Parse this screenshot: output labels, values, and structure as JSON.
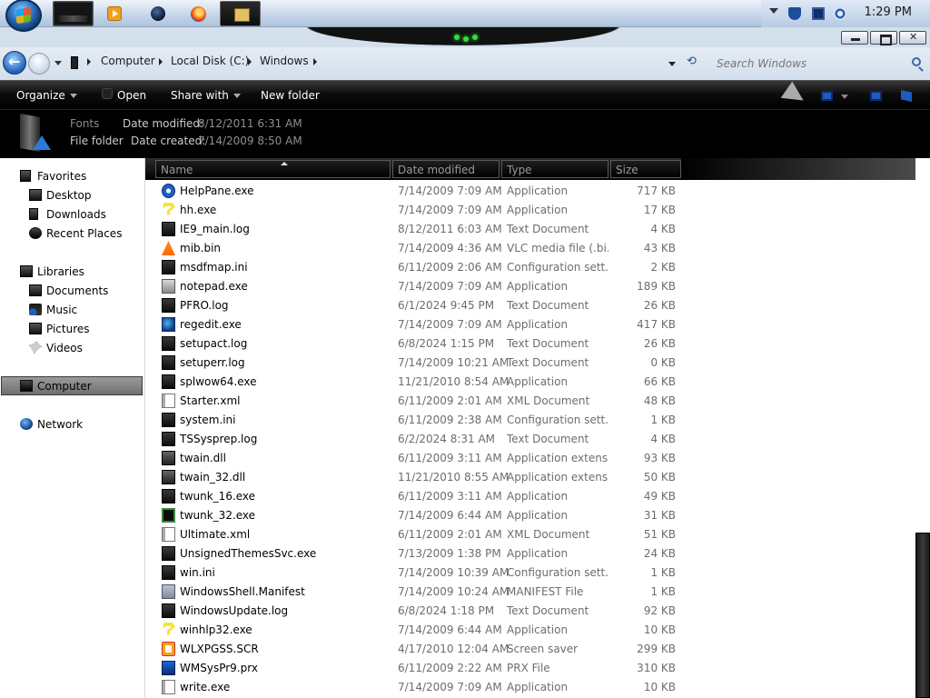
{
  "taskbar": {
    "clock": "1:29 PM"
  },
  "address": {
    "crumbs": [
      "Computer",
      "Local Disk (C:)",
      "Windows"
    ],
    "search_placeholder": "Search Windows"
  },
  "toolbar": {
    "organize_label": "Organize",
    "open_label": "Open",
    "share_label": "Share with",
    "new_folder_label": "New folder"
  },
  "details": {
    "name": "Fonts",
    "kind": "File folder",
    "modified_label": "Date modified:",
    "modified_value": "8/12/2011 6:31 AM",
    "created_label": "Date created:",
    "created_value": "7/14/2009 8:50 AM"
  },
  "nav": {
    "favorites": "Favorites",
    "desktop": "Desktop",
    "downloads": "Downloads",
    "recent_places": "Recent Places",
    "libraries": "Libraries",
    "documents": "Documents",
    "music": "Music",
    "pictures": "Pictures",
    "videos": "Videos",
    "computer": "Computer",
    "network": "Network"
  },
  "columns": {
    "name": "Name",
    "date_modified": "Date modified",
    "type": "Type",
    "size": "Size"
  },
  "files": [
    {
      "name": "HelpPane.exe",
      "date": "7/14/2009 7:09 AM",
      "type": "Application",
      "size": "717 KB",
      "icon": "help-icon"
    },
    {
      "name": "hh.exe",
      "date": "7/14/2009 7:09 AM",
      "type": "Application",
      "size": "17 KB",
      "icon": "question-icon"
    },
    {
      "name": "IE9_main.log",
      "date": "8/12/2011 6:03 AM",
      "type": "Text Document",
      "size": "4 KB",
      "icon": "text-doc-icon"
    },
    {
      "name": "mib.bin",
      "date": "7/14/2009 4:36 AM",
      "type": "VLC media file (.bi...",
      "size": "43 KB",
      "icon": "vlc-cone-icon"
    },
    {
      "name": "msdfmap.ini",
      "date": "6/11/2009 2:06 AM",
      "type": "Configuration sett...",
      "size": "2 KB",
      "icon": "config-icon"
    },
    {
      "name": "notepad.exe",
      "date": "7/14/2009 7:09 AM",
      "type": "Application",
      "size": "189 KB",
      "icon": "notepad-icon"
    },
    {
      "name": "PFRO.log",
      "date": "6/1/2024 9:45 PM",
      "type": "Text Document",
      "size": "26 KB",
      "icon": "text-doc-icon"
    },
    {
      "name": "regedit.exe",
      "date": "7/14/2009 7:09 AM",
      "type": "Application",
      "size": "417 KB",
      "icon": "regedit-icon"
    },
    {
      "name": "setupact.log",
      "date": "6/8/2024 1:15 PM",
      "type": "Text Document",
      "size": "26 KB",
      "icon": "text-doc-icon"
    },
    {
      "name": "setuperr.log",
      "date": "7/14/2009 10:21 AM",
      "type": "Text Document",
      "size": "0 KB",
      "icon": "text-doc-icon"
    },
    {
      "name": "splwow64.exe",
      "date": "11/21/2010 8:54 AM",
      "type": "Application",
      "size": "66 KB",
      "icon": "app-window-icon"
    },
    {
      "name": "Starter.xml",
      "date": "6/11/2009 2:01 AM",
      "type": "XML Document",
      "size": "48 KB",
      "icon": "xml-icon"
    },
    {
      "name": "system.ini",
      "date": "6/11/2009 2:38 AM",
      "type": "Configuration sett...",
      "size": "1 KB",
      "icon": "config-icon"
    },
    {
      "name": "TSSysprep.log",
      "date": "6/2/2024 8:31 AM",
      "type": "Text Document",
      "size": "4 KB",
      "icon": "text-doc-icon"
    },
    {
      "name": "twain.dll",
      "date": "6/11/2009 3:11 AM",
      "type": "Application extens...",
      "size": "93 KB",
      "icon": "dll-icon"
    },
    {
      "name": "twain_32.dll",
      "date": "11/21/2010 8:55 AM",
      "type": "Application extens...",
      "size": "50 KB",
      "icon": "dll-icon"
    },
    {
      "name": "twunk_16.exe",
      "date": "6/11/2009 3:11 AM",
      "type": "Application",
      "size": "49 KB",
      "icon": "app-window-icon"
    },
    {
      "name": "twunk_32.exe",
      "date": "7/14/2009 6:44 AM",
      "type": "Application",
      "size": "31 KB",
      "icon": "twunk-icon"
    },
    {
      "name": "Ultimate.xml",
      "date": "6/11/2009 2:01 AM",
      "type": "XML Document",
      "size": "51 KB",
      "icon": "xml-icon"
    },
    {
      "name": "UnsignedThemesSvc.exe",
      "date": "7/13/2009 1:38 PM",
      "type": "Application",
      "size": "24 KB",
      "icon": "app-window-icon"
    },
    {
      "name": "win.ini",
      "date": "7/14/2009 10:39 AM",
      "type": "Configuration sett...",
      "size": "1 KB",
      "icon": "config-icon"
    },
    {
      "name": "WindowsShell.Manifest",
      "date": "7/14/2009 10:24 AM",
      "type": "MANIFEST File",
      "size": "1 KB",
      "icon": "manifest-icon"
    },
    {
      "name": "WindowsUpdate.log",
      "date": "6/8/2024 1:18 PM",
      "type": "Text Document",
      "size": "92 KB",
      "icon": "text-doc-icon"
    },
    {
      "name": "winhlp32.exe",
      "date": "7/14/2009 6:44 AM",
      "type": "Application",
      "size": "10 KB",
      "icon": "question-icon"
    },
    {
      "name": "WLXPGSS.SCR",
      "date": "4/17/2010 12:04 AM",
      "type": "Screen saver",
      "size": "299 KB",
      "icon": "screensaver-icon"
    },
    {
      "name": "WMSysPr9.prx",
      "date": "6/11/2009 2:22 AM",
      "type": "PRX File",
      "size": "310 KB",
      "icon": "prx-icon"
    },
    {
      "name": "write.exe",
      "date": "7/14/2009 7:09 AM",
      "type": "Application",
      "size": "10 KB",
      "icon": "write-icon"
    }
  ]
}
